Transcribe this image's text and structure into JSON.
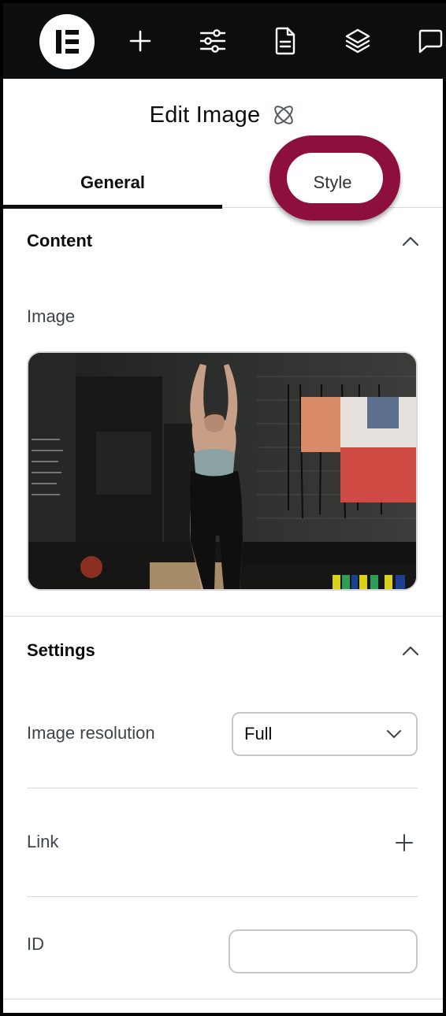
{
  "panel": {
    "title": "Edit Image"
  },
  "tabs": [
    {
      "label": "General",
      "active": true
    },
    {
      "label": "Style",
      "active": false
    }
  ],
  "content_section": {
    "title": "Content",
    "image_label": "Image"
  },
  "settings_section": {
    "title": "Settings",
    "resolution_label": "Image resolution",
    "resolution_value": "Full",
    "link_label": "Link",
    "id_label": "ID",
    "id_value": ""
  },
  "colors": {
    "accent_highlight": "#8c0f3e",
    "topbar": "#0c0d0e"
  },
  "topbar_icons": [
    "elementor-logo-icon",
    "add-icon",
    "sliders-icon",
    "page-icon",
    "layers-icon",
    "comment-icon"
  ]
}
